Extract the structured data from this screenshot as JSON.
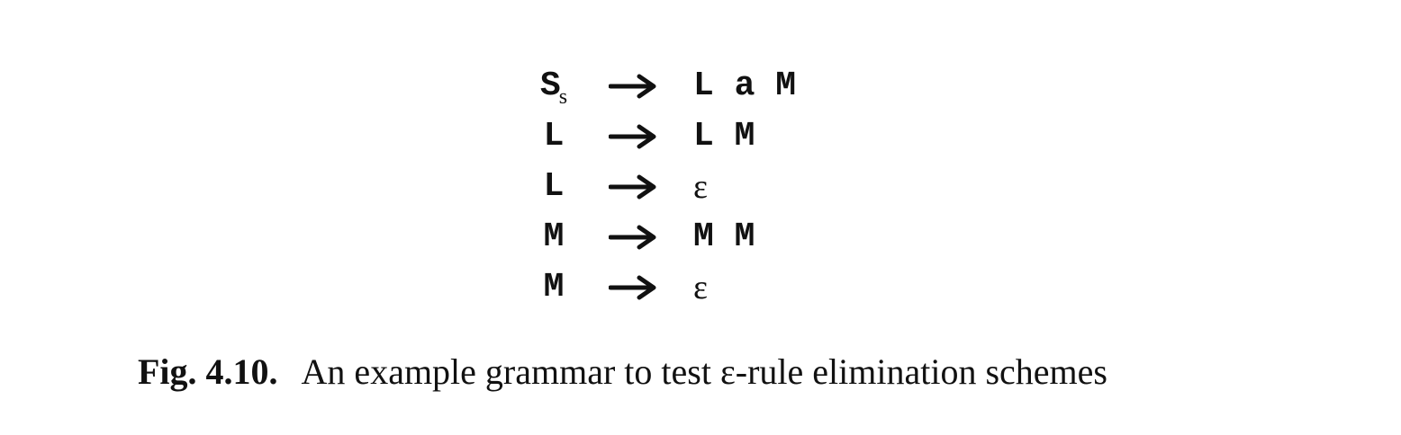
{
  "grammar": {
    "rules": [
      {
        "lhs": "S",
        "lhs_sub": "s",
        "rhs": "L a M",
        "rhs_is_epsilon": false
      },
      {
        "lhs": "L",
        "lhs_sub": "",
        "rhs": "L M",
        "rhs_is_epsilon": false
      },
      {
        "lhs": "L",
        "lhs_sub": "",
        "rhs": "ε",
        "rhs_is_epsilon": true
      },
      {
        "lhs": "M",
        "lhs_sub": "",
        "rhs": "M M",
        "rhs_is_epsilon": false
      },
      {
        "lhs": "M",
        "lhs_sub": "",
        "rhs": "ε",
        "rhs_is_epsilon": true
      }
    ]
  },
  "caption": {
    "label": "Fig. 4.10.",
    "text": "An example grammar to test ε-rule elimination schemes"
  }
}
